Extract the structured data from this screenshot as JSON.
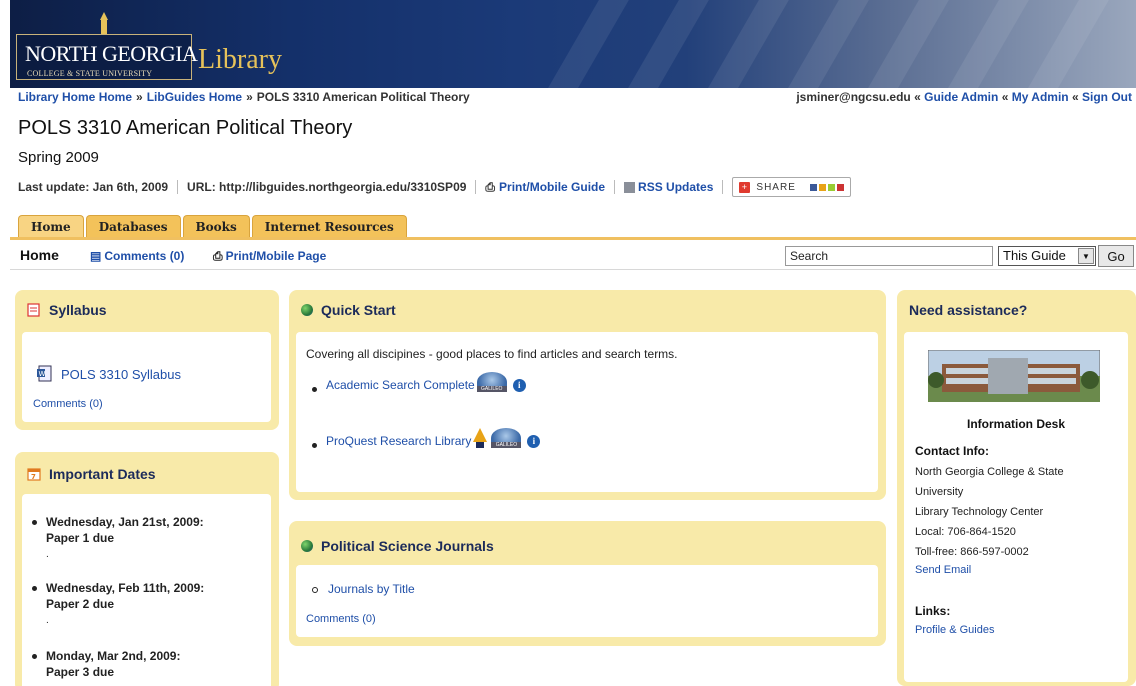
{
  "banner": {
    "university_name": "NORTH GEORGIA",
    "university_sub": "COLLEGE & STATE UNIVERSITY",
    "library_word": "Library"
  },
  "breadcrumb": {
    "items": [
      "Library Home Home",
      "LibGuides Home",
      "POLS 3310 American Political Theory"
    ],
    "separator": "»"
  },
  "userbar": {
    "email": "jsminer@ngcsu.edu",
    "separator": "«",
    "links": [
      "Guide Admin",
      "My Admin",
      "Sign Out"
    ]
  },
  "page": {
    "title": "POLS 3310 American Political Theory",
    "subtitle": "Spring 2009"
  },
  "meta": {
    "last_update": "Last update: Jan 6th, 2009",
    "url": "URL: http://libguides.northgeorgia.edu/3310SP09",
    "print_label": "Print/Mobile Guide",
    "rss_label": "RSS Updates",
    "share_label": "SHARE"
  },
  "tabs": [
    {
      "label": "Home"
    },
    {
      "label": "Databases"
    },
    {
      "label": "Books"
    },
    {
      "label": "Internet Resources"
    }
  ],
  "subnav": {
    "current": "Home",
    "comments": "Comments (0)",
    "print_page": "Print/Mobile Page",
    "search_value": "Search",
    "scope_value": "This Guide",
    "go_label": "Go"
  },
  "syllabus": {
    "header": "Syllabus",
    "link": "POLS 3310 Syllabus",
    "comments": "Comments (0)"
  },
  "dates": {
    "header": "Important Dates",
    "items": [
      {
        "date": "Wednesday, Jan 21st, 2009:",
        "event": "Paper 1 due"
      },
      {
        "date": "Wednesday, Feb 11th, 2009:",
        "event": "Paper 2 due"
      },
      {
        "date": "Monday, Mar 2nd, 2009:",
        "event": "Paper 3 due"
      }
    ]
  },
  "quickstart": {
    "header": "Quick Start",
    "intro": "Covering all discipines - good places to find articles and search terms.",
    "links": [
      "Academic Search Complete",
      "ProQuest Research Library"
    ],
    "galileo_text": "GALILEO"
  },
  "journals": {
    "header": "Political Science Journals",
    "links": [
      "Journals by Title"
    ],
    "comments": "Comments (0)"
  },
  "assist": {
    "header": "Need assistance?",
    "photo_caption": "Information Desk",
    "contact_label": "Contact Info:",
    "contact_lines": [
      "North Georgia College & State",
      "University",
      "Library Technology Center",
      "Local: 706-864-1520",
      "Toll-free: 866-597-0002"
    ],
    "email_link": "Send Email",
    "links_label": "Links:",
    "profile_link": "Profile & Guides"
  },
  "colors": {
    "box_bg": "#f8eaa9",
    "tab_bg": "#f3c25a",
    "link": "#1f4fa8",
    "banner": "#14306a"
  }
}
